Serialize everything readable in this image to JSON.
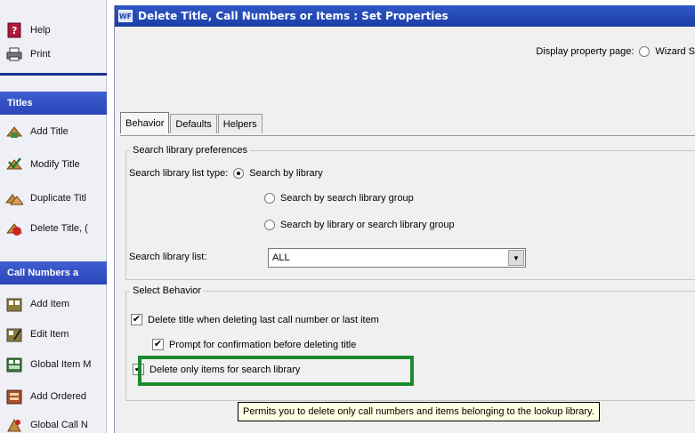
{
  "sidebar": {
    "items_top": [
      {
        "label": "Help",
        "icon": "help-book-icon"
      },
      {
        "label": "Print",
        "icon": "printer-icon"
      }
    ],
    "titles_header": "Titles",
    "title_items": [
      {
        "label": "Add Title",
        "icon": "add-title-icon"
      },
      {
        "label": "Modify Title",
        "icon": "modify-title-icon"
      },
      {
        "label": "Duplicate Titl",
        "icon": "duplicate-title-icon"
      },
      {
        "label": "Delete Title, (",
        "icon": "delete-title-icon"
      }
    ],
    "callnumbers_header": "Call Numbers a",
    "call_items": [
      {
        "label": "Add Item",
        "icon": "add-item-icon"
      },
      {
        "label": "Edit Item",
        "icon": "edit-item-icon"
      },
      {
        "label": "Global Item M",
        "icon": "global-item-icon"
      },
      {
        "label": "Add Ordered",
        "icon": "add-ordered-icon"
      },
      {
        "label": "Global Call N",
        "icon": "global-call-icon"
      }
    ]
  },
  "window": {
    "icon_text": "WF",
    "title": "Delete Title, Call Numbers or Items : Set Properties",
    "display_label": "Display property page:",
    "display_option": "Wizard S"
  },
  "tabs": [
    "Behavior",
    "Defaults",
    "Helpers"
  ],
  "search_prefs": {
    "legend": "Search library preferences",
    "list_type_label": "Search library list type:",
    "options": [
      "Search by library",
      "Search by search library group",
      "Search by library or search library group"
    ],
    "list_label": "Search library list:",
    "list_value": "ALL"
  },
  "select_behavior": {
    "legend": "Select Behavior",
    "delete_title": "Delete title when deleting last call number or last item",
    "prompt_confirm": "Prompt for confirmation before deleting title",
    "delete_only": "Delete only items for search library"
  },
  "tooltip": "Permits you to delete only call numbers and items belonging to the lookup library.",
  "colors": {
    "accent": "#2f57c7",
    "highlight": "#1c8b2e",
    "tooltip_bg": "#ffffe1"
  }
}
